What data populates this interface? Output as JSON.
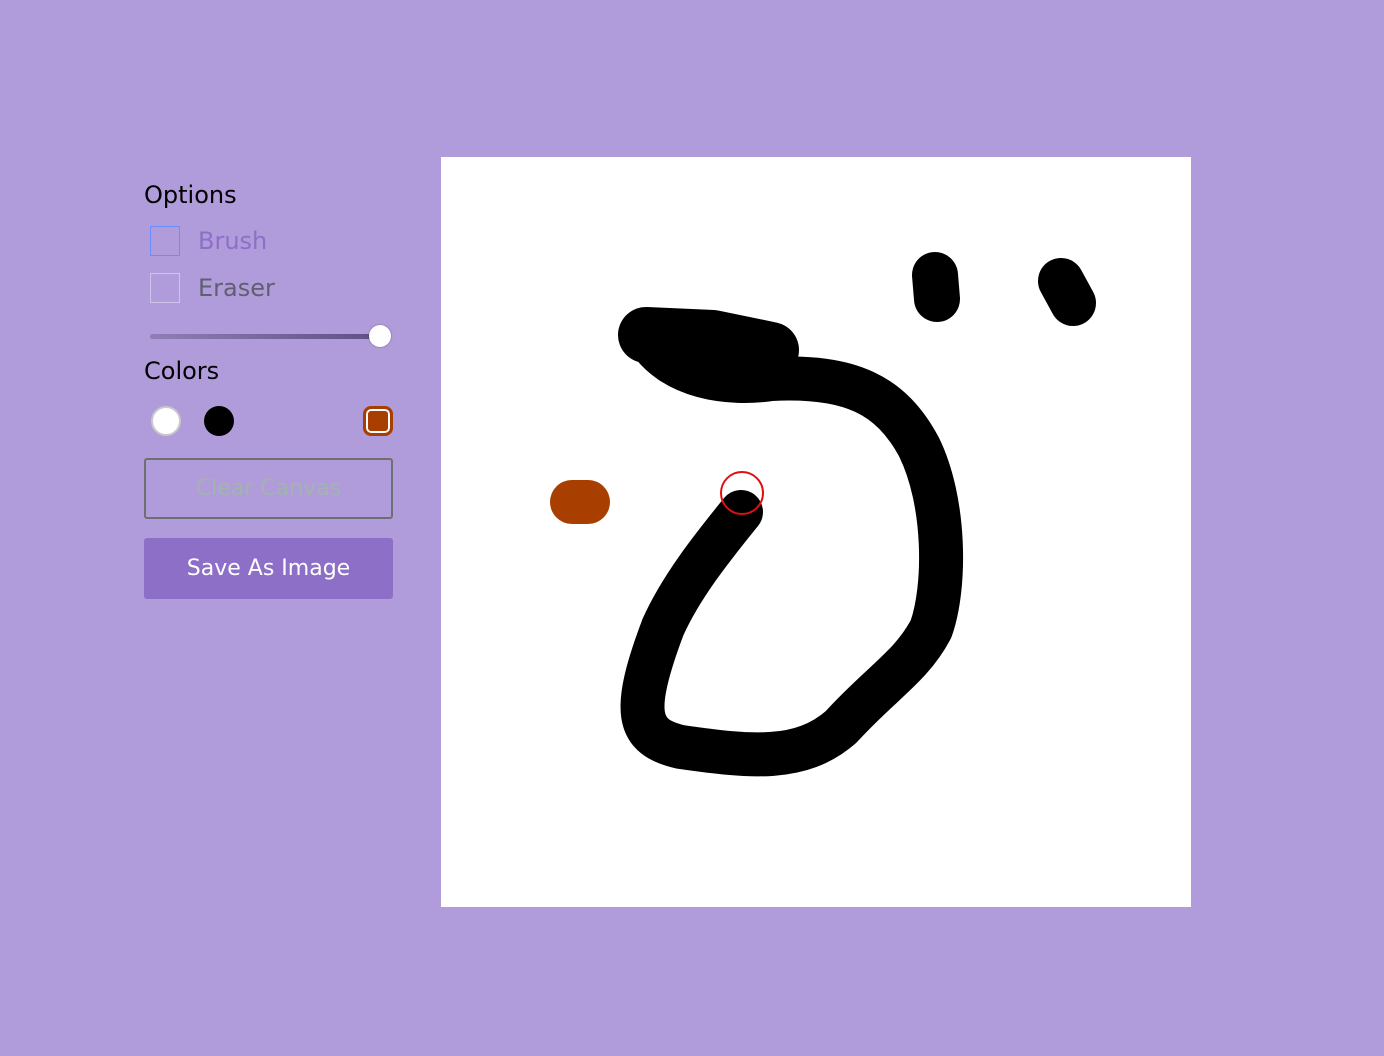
{
  "options": {
    "title": "Options",
    "brush_label": "Brush",
    "eraser_label": "Eraser",
    "brush_size": 1.0
  },
  "colors": {
    "title": "Colors",
    "swatches": [
      {
        "name": "white",
        "hex": "#ffffff"
      },
      {
        "name": "black",
        "hex": "#000000"
      },
      {
        "name": "rust",
        "hex": "#a83e00",
        "selected": true
      }
    ]
  },
  "buttons": {
    "clear_label": "Clear Canvas",
    "save_label": "Save As Image"
  },
  "theme": {
    "background": "#b09cda",
    "accent": "#8e6fc8",
    "brush_label_color": "#8e6fc8",
    "eraser_label_color": "#5f5f6f",
    "clear_label_color": "#a3b3ad",
    "save_text_color": "#ffffff",
    "cursor_ring": "#e01010"
  }
}
